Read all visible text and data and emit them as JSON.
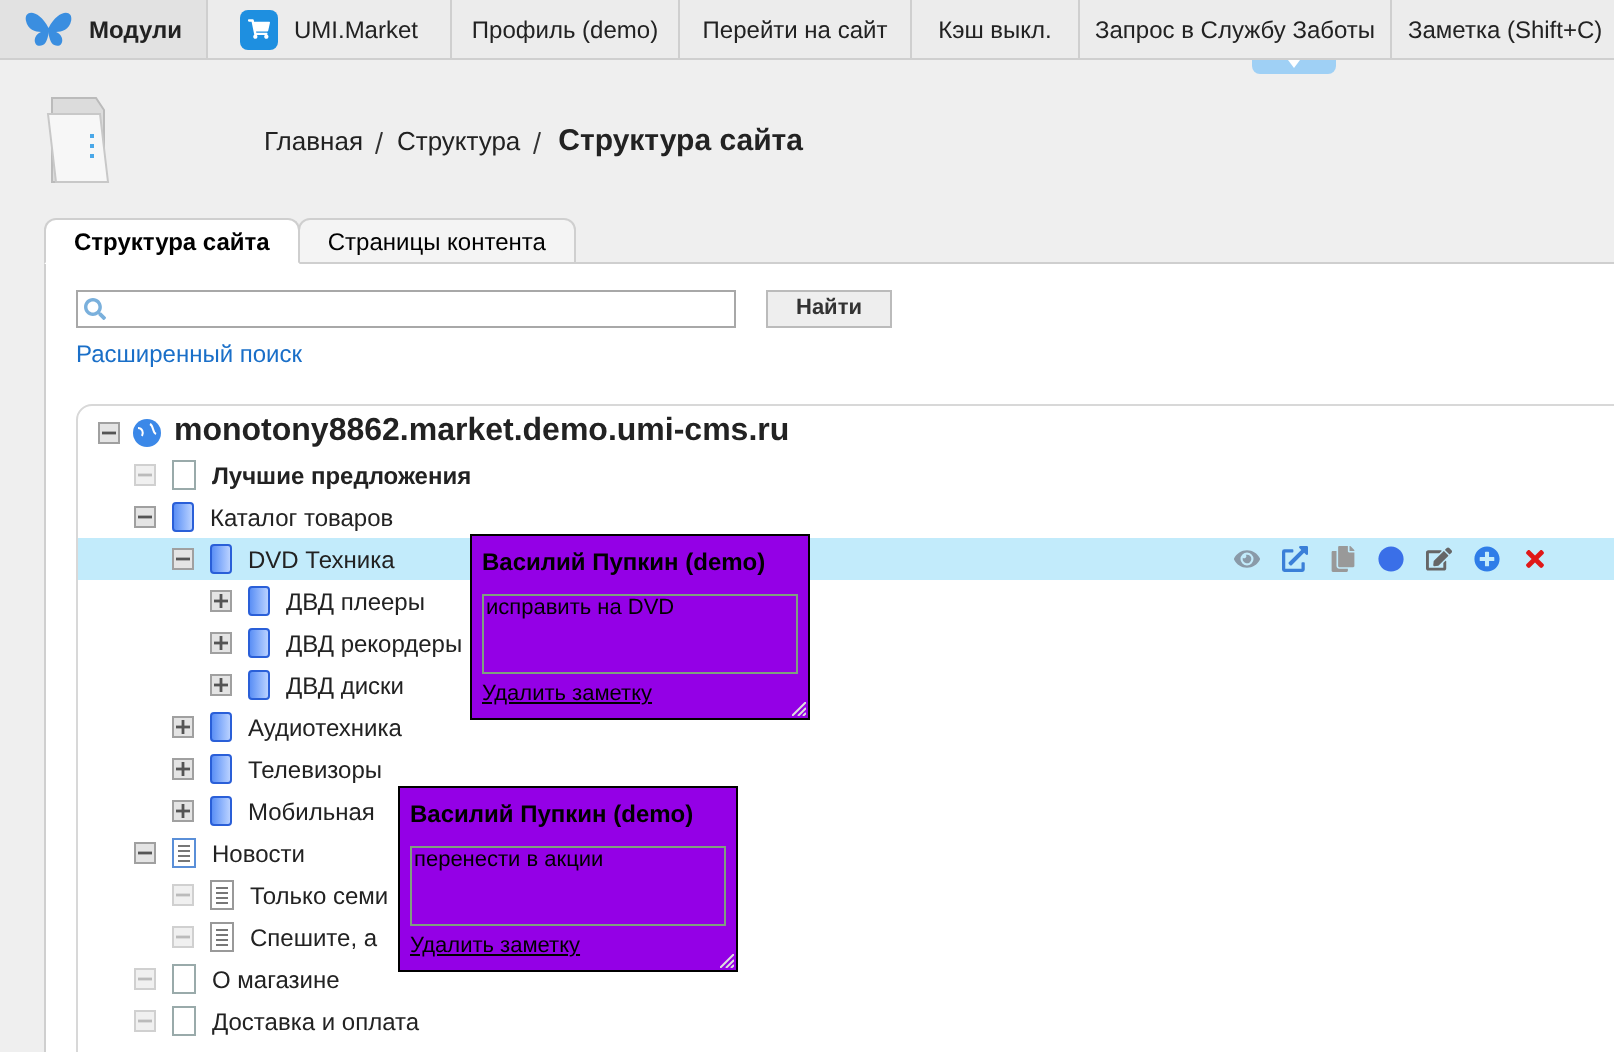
{
  "top_menu": [
    {
      "label": "Модули",
      "kind": "logo"
    },
    {
      "label": "UMI.Market",
      "kind": "market"
    },
    {
      "label": "Профиль (demo)",
      "kind": "plain"
    },
    {
      "label": "Перейти на сайт",
      "kind": "plain"
    },
    {
      "label": "Кэш выкл.",
      "kind": "plain"
    },
    {
      "label": "Запрос в Службу Заботы",
      "kind": "plain"
    },
    {
      "label": "Заметка (Shift+C)",
      "kind": "plain"
    }
  ],
  "breadcrumbs": [
    "Главная",
    "Структура"
  ],
  "page_title": "Структура сайта",
  "tabs": [
    {
      "label": "Структура сайта",
      "selected": true
    },
    {
      "label": "Страницы контента",
      "selected": false
    }
  ],
  "search": {
    "button": "Найти",
    "advanced_link": "Расширенный поиск"
  },
  "tree": {
    "label": "monotony8862.market.demo.umi-cms.ru",
    "expanded": true,
    "children": [
      {
        "label": "Лучшие предложения",
        "kind": "page",
        "bold": true,
        "selected": false,
        "expanded": true
      },
      {
        "label": "Каталог товаров",
        "kind": "catalog",
        "bold": false,
        "selected": false,
        "expanded": true,
        "children": [
          {
            "label": "DVD Техника",
            "kind": "catalog",
            "bold": false,
            "selected": true,
            "expanded": true,
            "children": [
              {
                "label": "ДВД плееры",
                "kind": "catalog",
                "bold": false,
                "selected": false,
                "expanded": false
              },
              {
                "label": "ДВД рекордеры",
                "kind": "catalog",
                "bold": false,
                "selected": false,
                "expanded": false
              },
              {
                "label": "ДВД диски",
                "kind": "catalog",
                "bold": false,
                "selected": false,
                "expanded": false
              }
            ]
          },
          {
            "label": "Аудиотехника",
            "kind": "catalog",
            "bold": false,
            "selected": false,
            "expanded": false
          },
          {
            "label": "Телевизоры",
            "kind": "catalog",
            "bold": false,
            "selected": false,
            "expanded": false
          },
          {
            "label": "Мобильная",
            "kind": "catalog",
            "bold": false,
            "selected": false,
            "expanded": false
          }
        ]
      },
      {
        "label": "Новости",
        "kind": "news",
        "bold": false,
        "selected": false,
        "expanded": true,
        "children": [
          {
            "label": "Только семи",
            "kind": "doc",
            "bold": false,
            "selected": false,
            "expanded": true
          },
          {
            "label": "Спешите, а",
            "kind": "doc",
            "bold": false,
            "selected": false,
            "expanded": true
          }
        ]
      },
      {
        "label": "О магазине",
        "kind": "page",
        "bold": false,
        "selected": false,
        "expanded": true
      },
      {
        "label": "Доставка и оплата",
        "kind": "page",
        "bold": false,
        "selected": false,
        "expanded": true
      }
    ]
  },
  "notes": [
    {
      "author": "Василий Пупкин (demo)",
      "text": "исправить на DVD",
      "delete_link": "Удалить заметку"
    },
    {
      "author": "Василий Пупкин (demo)",
      "text": "перенести в акции",
      "delete_link": "Удалить заметку"
    }
  ]
}
